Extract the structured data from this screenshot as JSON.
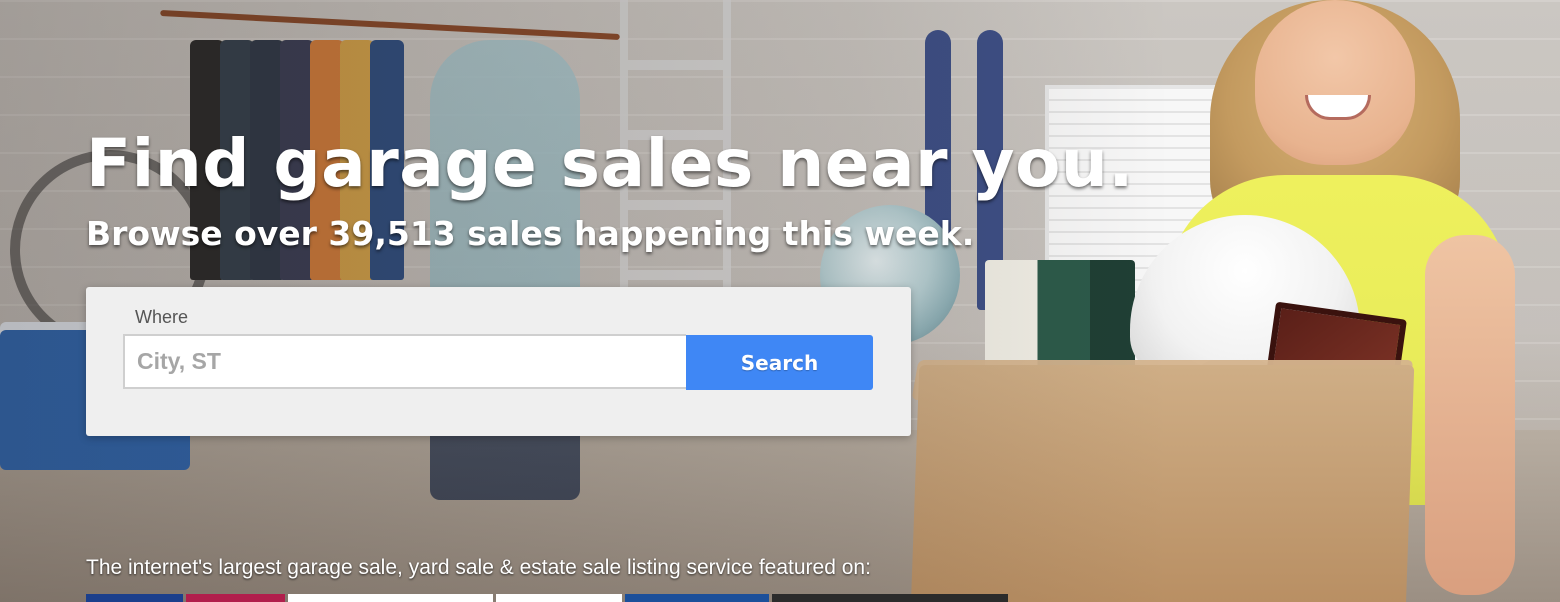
{
  "hero": {
    "headline": "Find garage sales near you.",
    "subheadline": "Browse over 39,513 sales happening this week."
  },
  "search": {
    "where_label": "Where",
    "placeholder": "City, ST",
    "value": "",
    "button_label": "Search"
  },
  "featured": {
    "text": "The internet's largest garage sale, yard sale & estate sale listing service featured on:"
  },
  "colors": {
    "accent": "#3f87f5",
    "panel": "#efefef"
  }
}
